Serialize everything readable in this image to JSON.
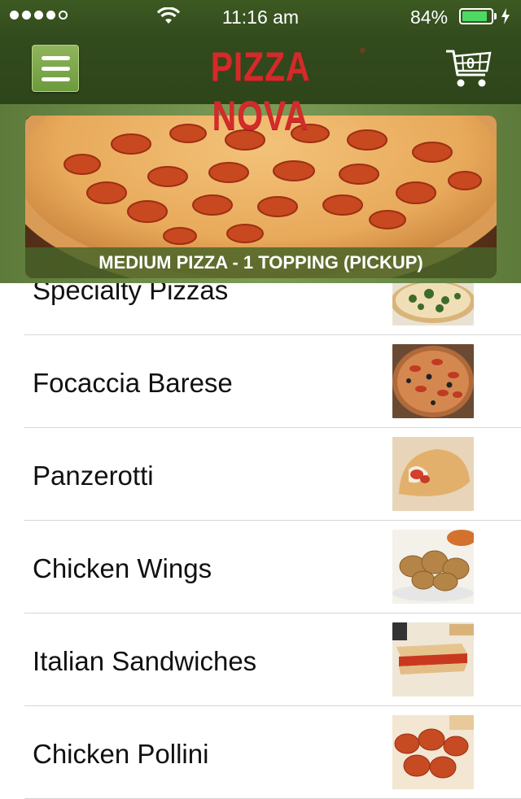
{
  "status_bar": {
    "time": "11:16 am",
    "battery_percent": "84%",
    "signal_bars": 4,
    "signal_total": 5,
    "battery_level": 0.84
  },
  "nav": {
    "logo_text": "PIZZA NOVA",
    "logo_mark": "®",
    "menu_icon": "hamburger-icon",
    "cart_icon": "cart-icon",
    "cart_count": "0"
  },
  "promo": {
    "caption": "MEDIUM PIZZA - 1 TOPPING (PICKUP)",
    "image": "pepperoni-pizza-photo"
  },
  "menu_items": [
    {
      "label": "Specialty Pizzas",
      "image": "specialty-pizza-photo"
    },
    {
      "label": "Focaccia Barese",
      "image": "focaccia-photo"
    },
    {
      "label": "Panzerotti",
      "image": "panzerotti-photo"
    },
    {
      "label": "Chicken Wings",
      "image": "chicken-wings-photo"
    },
    {
      "label": "Italian Sandwiches",
      "image": "sandwich-photo"
    },
    {
      "label": "Chicken Pollini",
      "image": "chicken-pollini-photo"
    }
  ],
  "colors": {
    "header_bg": "#324b1d",
    "logo_red": "#d42a2a",
    "accent_green": "#6d9a3d",
    "divider": "#d6d6d6"
  }
}
